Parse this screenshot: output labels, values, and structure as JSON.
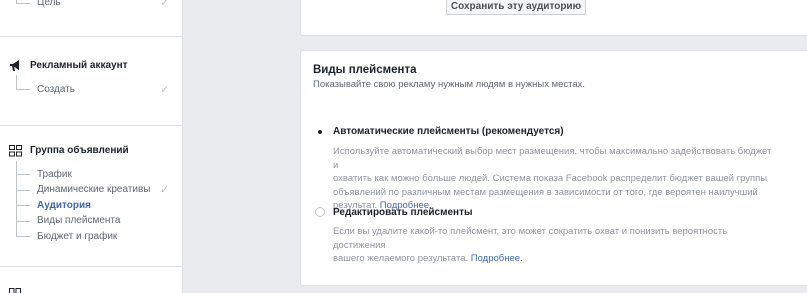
{
  "sidebar": {
    "top_item": {
      "label": "Цель",
      "done": true
    },
    "account": {
      "title": "Рекламный аккаунт",
      "icon": "megaphone-icon",
      "items": [
        {
          "label": "Создать",
          "done": true
        }
      ]
    },
    "ad_group": {
      "title": "Группа объявлений",
      "icon": "grid-icon",
      "items": [
        {
          "label": "Трафик",
          "done": false,
          "active": false
        },
        {
          "label": "Динамические креативы",
          "done": true,
          "active": false
        },
        {
          "label": "Аудитория",
          "done": false,
          "active": true
        },
        {
          "label": "Виды плейсмента",
          "done": false,
          "active": false
        },
        {
          "label": "Бюджет и график",
          "done": false,
          "active": false
        }
      ]
    },
    "check_glyph": "✓"
  },
  "audience": {
    "save_label": "Сохранить эту аудиторию"
  },
  "placements": {
    "title": "Виды плейсмента",
    "subtitle": "Показывайте свою рекламу нужным людям в нужных местах.",
    "options": [
      {
        "label": "Автоматические плейсменты (рекомендуется)",
        "selected": true,
        "desc_lines": [
          "Используйте автоматический выбор мест размещения, чтобы максимально задействовать бюджет и",
          "охватить как можно больше людей. Система показа Facebook распределит бюджет вашей группы",
          "объявлений по различным местам размещения в зависимости от того, где вероятен наилучший"
        ],
        "desc_last": "результат.",
        "link": "Подробнее."
      },
      {
        "label": "Редактировать плейсменты",
        "selected": false,
        "desc_lines": [
          "Если вы удалите какой-то плейсмент, это может сократить охват и понизить вероятность достижения"
        ],
        "desc_last": "вашего желаемого результата.",
        "link": "Подробнее."
      }
    ]
  },
  "colors": {
    "accent": "#4267b2",
    "text": "#1d2129",
    "muted": "#606770",
    "background": "#e9ebee"
  }
}
